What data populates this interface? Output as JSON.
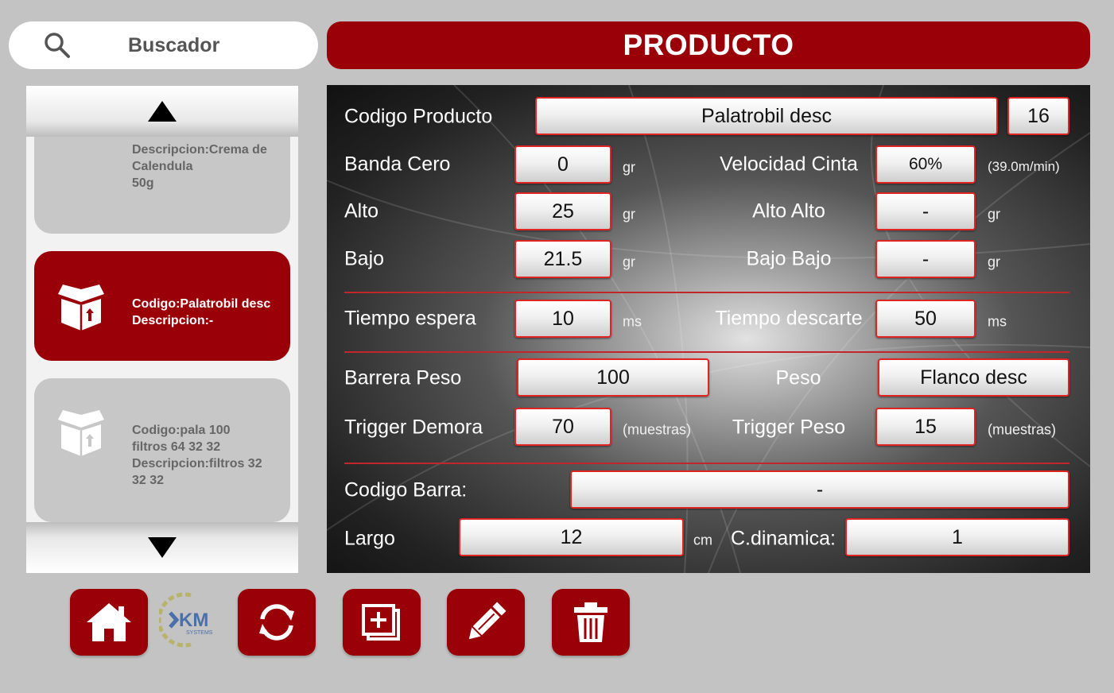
{
  "search": {
    "label": "Buscador",
    "icon": "search-icon"
  },
  "title": "PRODUCTO",
  "product_list": {
    "items": [
      {
        "lines": [
          "Descripcion:Crema de",
          "Calendula",
          "50g"
        ],
        "selected": false
      },
      {
        "lines": [
          "Codigo:Palatrobil desc",
          "Descripcion:-"
        ],
        "selected": true
      },
      {
        "lines": [
          "Codigo:pala 100",
          "filtros 64 32 32",
          "Descripcion:filtros 32",
          "32 32"
        ],
        "selected": false
      }
    ]
  },
  "form": {
    "codigo_producto": {
      "label": "Codigo Producto",
      "value": "Palatrobil desc",
      "number": "16"
    },
    "banda_cero": {
      "label": "Banda Cero",
      "value": "0",
      "unit": "gr"
    },
    "velocidad_cinta": {
      "label": "Velocidad Cinta",
      "value": "60%",
      "unit": "(39.0m/min)"
    },
    "alto": {
      "label": "Alto",
      "value": "25",
      "unit": "gr"
    },
    "alto_alto": {
      "label": "Alto Alto",
      "value": "-",
      "unit": "gr"
    },
    "bajo": {
      "label": "Bajo",
      "value": "21.5",
      "unit": "gr"
    },
    "bajo_bajo": {
      "label": "Bajo Bajo",
      "value": "-",
      "unit": "gr"
    },
    "tiempo_espera": {
      "label": "Tiempo espera",
      "value": "10",
      "unit": "ms"
    },
    "tiempo_descarte": {
      "label": "Tiempo descarte",
      "value": "50",
      "unit": "ms"
    },
    "barrera_peso": {
      "label": "Barrera Peso",
      "value": "100"
    },
    "peso": {
      "label": "Peso",
      "value": "Flanco desc"
    },
    "trigger_demora": {
      "label": "Trigger Demora",
      "value": "70",
      "unit": "(muestras)"
    },
    "trigger_peso": {
      "label": "Trigger Peso",
      "value": "15",
      "unit": "(muestras)"
    },
    "codigo_barra": {
      "label": "Codigo Barra:",
      "value": "-"
    },
    "largo": {
      "label": "Largo",
      "value": "12",
      "unit": "cm"
    },
    "c_dinamica": {
      "label": "C.dinamica:",
      "value": "1"
    }
  },
  "toolbar": {
    "buttons": [
      "home-icon",
      "refresh-icon",
      "add-icon",
      "edit-icon",
      "delete-icon"
    ],
    "logo_text": "KM",
    "logo_subtext": "SYSTEMS"
  },
  "colors": {
    "brand_red": "#9a0008",
    "field_border": "#e02424",
    "background": "#c3c3c3"
  }
}
